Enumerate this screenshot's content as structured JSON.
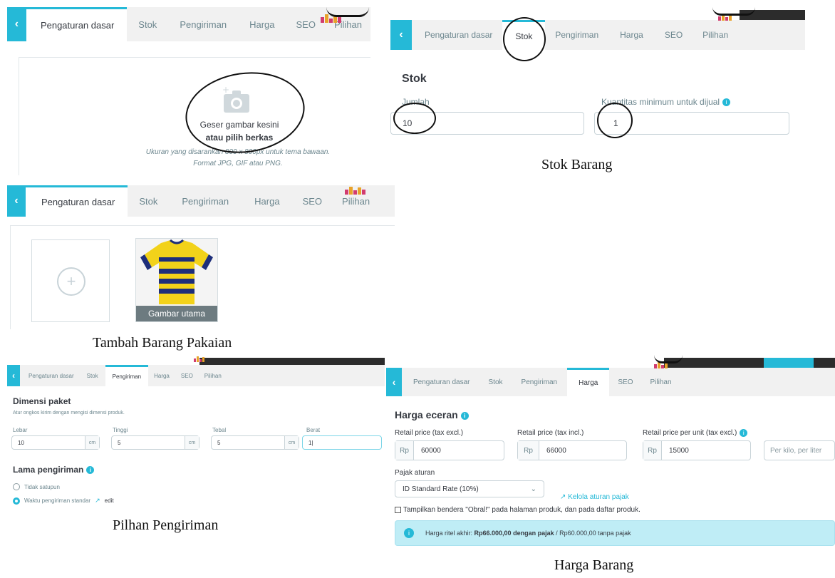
{
  "tabs": [
    "Pengaturan dasar",
    "Stok",
    "Pengiriman",
    "Harga",
    "SEO",
    "Pilihan"
  ],
  "back_label": "‹",
  "panel_upload": {
    "drop_text": "Geser gambar kesini",
    "pick_text": "atau pilih berkas",
    "hint_line1": "Ukuran yang disarankan 800 x 800px untuk tema bawaan.",
    "hint_line2": "Format JPG, GIF atau PNG."
  },
  "panel_stok": {
    "title": "Stok",
    "qty_label": "Jumlah",
    "qty_value": "10",
    "min_label": "Kuantitas minimum untuk dijual",
    "min_value": "1"
  },
  "panel_images": {
    "main_image_label": "Gambar utama",
    "add_symbol": "+"
  },
  "panel_shipping": {
    "title": "Dimensi paket",
    "subtitle": "Atur ongkos kirim dengan mengisi dimensi produk.",
    "width_label": "Lebar",
    "width_value": "10",
    "height_label": "Tinggi",
    "height_value": "5",
    "depth_label": "Tebal",
    "depth_value": "5",
    "weight_label": "Berat",
    "weight_value": "1|",
    "unit": "cm",
    "delivery_title": "Lama pengiriman",
    "option_none": "Tidak satupun",
    "option_standard": "Waktu pengiriman standar",
    "edit_label": "edit"
  },
  "panel_price": {
    "title": "Harga eceran",
    "retail_excl_label": "Retail price (tax excl.)",
    "retail_excl_value": "60000",
    "retail_incl_label": "Retail price (tax incl.)",
    "retail_incl_value": "66000",
    "unit_price_label": "Retail price per unit (tax excl.)",
    "unit_price_value": "15000",
    "per_unit_placeholder": "Per kilo, per liter",
    "currency": "Rp",
    "tax_rule_label": "Pajak aturan",
    "tax_rule_value": "ID Standard Rate (10%)",
    "manage_tax_link": "Kelola aturan pajak",
    "sale_flag_text": "Tampilkan bendera \"Obral!\" pada halaman produk, dan pada daftar produk.",
    "final_price_prefix": "Harga ritel akhir: ",
    "final_price_bold": "Rp66.000,00 dengan pajak",
    "final_price_suffix": " / Rp60.000,00 tanpa pajak"
  },
  "captions": {
    "stok": "Stok Barang",
    "pakaian": "Tambah Barang Pakaian",
    "pengiriman": "Pilhan Pengiriman",
    "harga": "Harga Barang"
  },
  "colors": {
    "accent": "#25b9d7",
    "tab_bar": "#f1f1f1",
    "info_banner": "#bfedf6"
  }
}
